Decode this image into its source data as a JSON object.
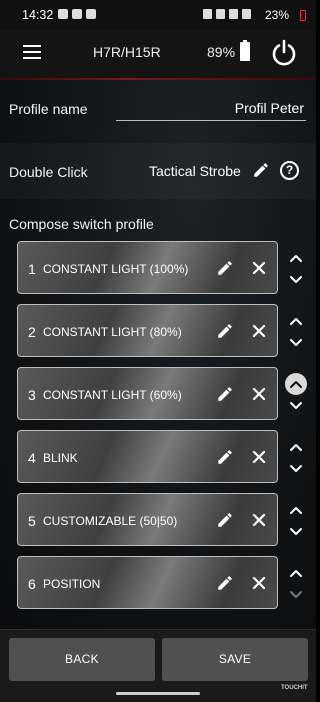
{
  "status_bar": {
    "time": "14:32",
    "battery": "23%"
  },
  "header": {
    "title": "H7R/H15R",
    "battery_pct": "89%"
  },
  "profile": {
    "label": "Profile name",
    "value": "Profil Peter"
  },
  "double_click": {
    "label": "Double Click",
    "value": "Tactical Strobe"
  },
  "compose_label": "Compose switch profile",
  "rows": [
    {
      "num": "1",
      "label": "CONSTANT LIGHT (100%)"
    },
    {
      "num": "2",
      "label": "CONSTANT LIGHT (80%)"
    },
    {
      "num": "3",
      "label": "CONSTANT LIGHT (60%)"
    },
    {
      "num": "4",
      "label": "BLINK"
    },
    {
      "num": "5",
      "label": "CUSTOMIZABLE (50|50)"
    },
    {
      "num": "6",
      "label": "POSITION"
    }
  ],
  "buttons": {
    "back": "BACK",
    "save": "SAVE"
  },
  "watermark": "TOUCHIT",
  "icons": [
    "menu-icon",
    "battery-icon",
    "power-icon",
    "pencil-icon",
    "help-icon",
    "close-icon",
    "chevron-up-icon",
    "chevron-down-icon"
  ]
}
